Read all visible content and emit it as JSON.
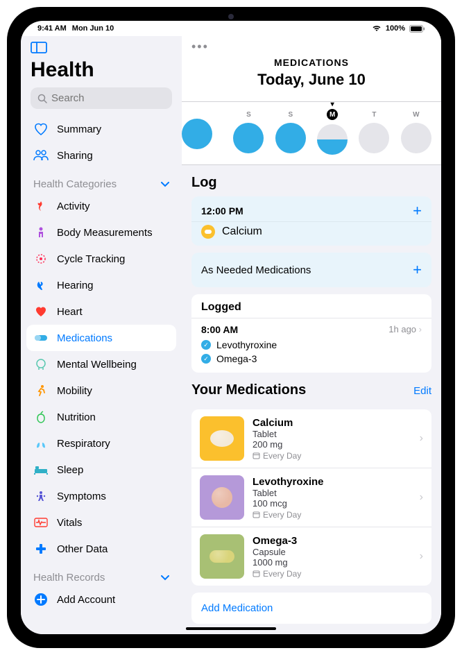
{
  "status": {
    "time": "9:41 AM",
    "date": "Mon Jun 10",
    "battery": "100%"
  },
  "sidebar": {
    "title": "Health",
    "search_placeholder": "Search",
    "nav_top": [
      {
        "label": "Summary",
        "icon": "heart-outline"
      },
      {
        "label": "Sharing",
        "icon": "people"
      }
    ],
    "categories_title": "Health Categories",
    "categories": [
      {
        "label": "Activity",
        "color": "#ff3b30"
      },
      {
        "label": "Body Measurements",
        "color": "#af52de"
      },
      {
        "label": "Cycle Tracking",
        "color": "#ff2d55"
      },
      {
        "label": "Hearing",
        "color": "#007aff"
      },
      {
        "label": "Heart",
        "color": "#ff3b30"
      },
      {
        "label": "Medications",
        "color": "#32ade6",
        "selected": true
      },
      {
        "label": "Mental Wellbeing",
        "color": "#5ac8b0"
      },
      {
        "label": "Mobility",
        "color": "#ff9500"
      },
      {
        "label": "Nutrition",
        "color": "#34c759"
      },
      {
        "label": "Respiratory",
        "color": "#5ac8fa"
      },
      {
        "label": "Sleep",
        "color": "#30b0c7"
      },
      {
        "label": "Symptoms",
        "color": "#5856d6"
      },
      {
        "label": "Vitals",
        "color": "#ff3b30"
      },
      {
        "label": "Other Data",
        "color": "#007aff"
      }
    ],
    "records_title": "Health Records",
    "add_account": "Add Account"
  },
  "main": {
    "title": "MEDICATIONS",
    "today_title": "Today, June 10",
    "week": [
      {
        "label": "",
        "fill": "full",
        "edge": true
      },
      {
        "label": "S",
        "fill": "full"
      },
      {
        "label": "S",
        "fill": "full"
      },
      {
        "label": "M",
        "fill": "half",
        "today": true
      },
      {
        "label": "T",
        "fill": "none"
      },
      {
        "label": "W",
        "fill": "none"
      }
    ],
    "log_title": "Log",
    "pending": {
      "time": "12:00 PM",
      "med": "Calcium"
    },
    "as_needed": "As Needed Medications",
    "logged_title": "Logged",
    "logged": {
      "time": "8:00 AM",
      "ago": "1h ago",
      "meds": [
        "Levothyroxine",
        "Omega-3"
      ]
    },
    "your_meds_title": "Your Medications",
    "edit": "Edit",
    "meds": [
      {
        "name": "Calcium",
        "form": "Tablet",
        "dose": "200 mg",
        "freq": "Every Day",
        "color": "yellow",
        "shape": "tablet"
      },
      {
        "name": "Levothyroxine",
        "form": "Tablet",
        "dose": "100 mcg",
        "freq": "Every Day",
        "color": "purple",
        "shape": "round"
      },
      {
        "name": "Omega-3",
        "form": "Capsule",
        "dose": "1000 mg",
        "freq": "Every Day",
        "color": "green",
        "shape": "capsule"
      }
    ],
    "add_medication": "Add Medication"
  }
}
